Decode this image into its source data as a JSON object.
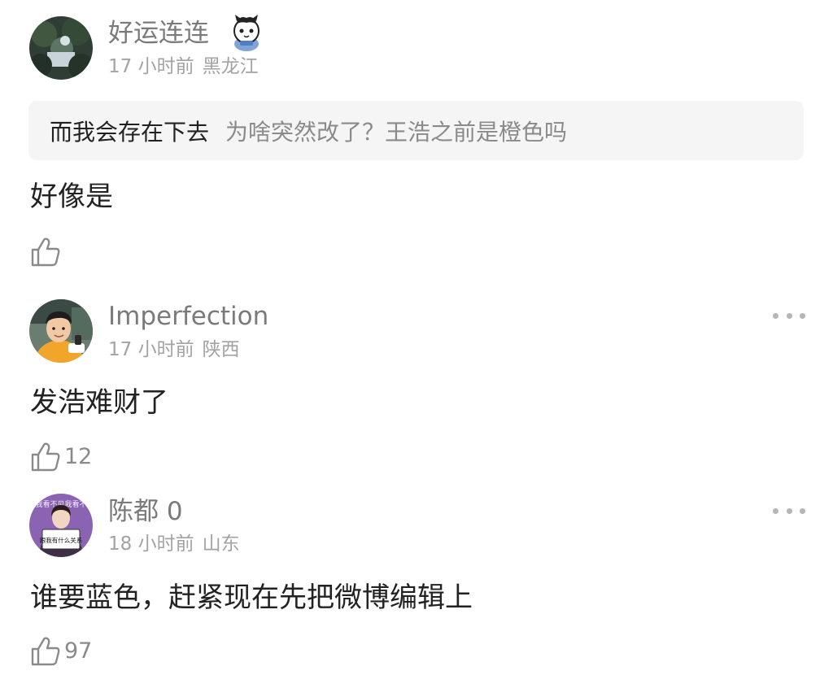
{
  "colors": {
    "username": "#7a7a7a",
    "meta": "#a3a3a3",
    "body": "#222222",
    "quote_bg": "#f5f5f5",
    "quote_text": "#8a8a8a",
    "icon": "#8a8a8a"
  },
  "comments": [
    {
      "username": "好运连连",
      "time": "17 小时前",
      "location": "黑龙江",
      "badge_icon": "cat-badge-icon",
      "quote": {
        "title": "而我会存在下去",
        "text": "为啥突然改了？王浩之前是橙色吗"
      },
      "text": "好像是",
      "likes": ""
    },
    {
      "username": "Imperfection",
      "time": "17 小时前",
      "location": "陕西",
      "text": "发浩难财了",
      "likes": "12"
    },
    {
      "username": "陈都 0",
      "time": "18 小时前",
      "location": "山东",
      "text": "谁要蓝色，赶紧现在先把微博编辑上",
      "likes": "97",
      "avatar_sign_text": "跟我有什么关系",
      "avatar_banner_text": "我看不见我看不"
    }
  ]
}
